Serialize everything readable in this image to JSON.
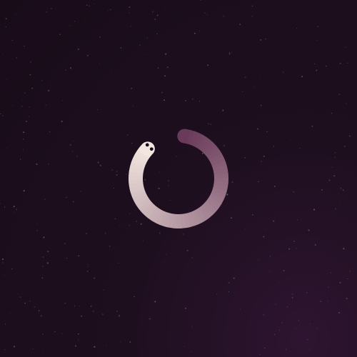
{
  "screen": {
    "background_color": "#1e0f1f",
    "star_colors": [
      "#6a5566",
      "#4f6a6a",
      "#7a6075",
      "#5a4a5a"
    ]
  },
  "loader": {
    "icon": "snake-loading-spinner-icon",
    "progress_percent": 85,
    "head_color": "#f2e6df",
    "tail_color": "#6a3a5a",
    "eye_color": "#1a0d1a"
  }
}
